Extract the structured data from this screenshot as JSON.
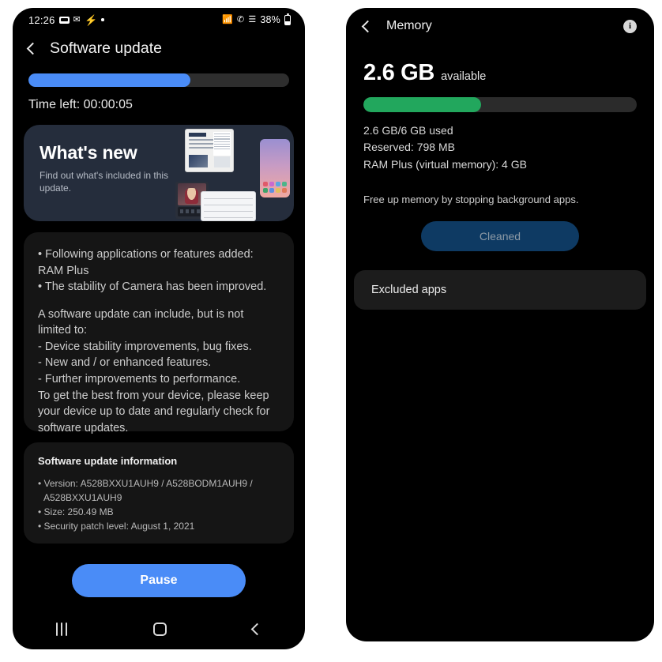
{
  "left_phone": {
    "status_bar": {
      "clock": "12:26",
      "left_icons": [
        "camera-icon",
        "mail-icon",
        "bolt-icon",
        "dot-icon"
      ],
      "right_icons": [
        "wifi-icon",
        "call-icon",
        "signal-icon"
      ],
      "battery_percent": "38%"
    },
    "appbar": {
      "back": "back-chevron",
      "title": "Software update"
    },
    "progress": {
      "percent": 62,
      "time_left": "Time left: 00:00:05"
    },
    "whats_new": {
      "title": "What's new",
      "subtitle": "Find out what's included in this update."
    },
    "release_notes": {
      "block1": "• Following applications or features added: RAM Plus\n• The stability of Camera has been improved.",
      "block2": "A software update can include, but is not limited to:\n - Device stability improvements, bug fixes.\n - New and / or enhanced features.\n - Further improvements to performance.\nTo get the best from your device, please keep your device up to date and regularly check for software updates."
    },
    "update_info": {
      "title": "Software update information",
      "items": [
        {
          "line1": "• Version: A528BXXU1AUH9 / A528BODM1AUH9 /",
          "line2": "A528BXXU1AUH9"
        },
        {
          "line1": "• Size: 250.49 MB",
          "line2": ""
        },
        {
          "line1": "• Security patch level: August 1, 2021",
          "line2": ""
        }
      ]
    },
    "pause_button": "Pause",
    "nav_bar": [
      "recent-apps-icon",
      "home-icon",
      "back-icon"
    ],
    "colors": {
      "accent": "#4a8cf7",
      "card": "#252d3c"
    }
  },
  "right_phone": {
    "appbar": {
      "back": "back-chevron",
      "title": "Memory",
      "info": "info-icon"
    },
    "memory": {
      "available_value": "2.6 GB",
      "available_label": "available",
      "bar_percent": 43,
      "used_line": "2.6 GB/6 GB used",
      "reserved_line": "Reserved: 798 MB",
      "ramplus_line": "RAM Plus (virtual memory): 4 GB",
      "hint": "Free up memory by stopping background apps.",
      "clean_button": "Cleaned"
    },
    "excluded_apps": "Excluded apps",
    "colors": {
      "bar": "#22a75d",
      "button": "#0e3a63"
    }
  }
}
